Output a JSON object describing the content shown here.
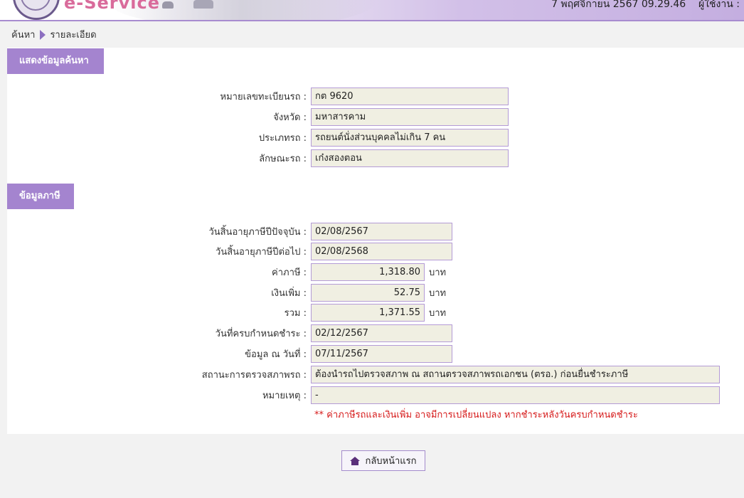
{
  "header": {
    "brand": "e-Service",
    "datetime": "7 พฤศจิกายน 2567 09.29.46",
    "user_label": "ผู้ใช้งาน :"
  },
  "breadcrumb": {
    "search": "ค้นหา",
    "detail": "รายละเอียด"
  },
  "vehicle_section": {
    "title": "แสดงข้อมูลค้นหา",
    "fields": [
      {
        "label": "หมายเลขทะเบียนรถ :",
        "value": "กต 9620"
      },
      {
        "label": "จังหวัด :",
        "value": "มหาสารคาม"
      },
      {
        "label": "ประเภทรถ :",
        "value": "รถยนต์นั่งส่วนบุคคลไม่เกิน 7 คน"
      },
      {
        "label": "ลักษณะรถ :",
        "value": "เก๋งสองตอน"
      }
    ]
  },
  "tax_section": {
    "title": "ข้อมูลภาษี",
    "current_expiry": {
      "label": "วันสิ้นอายุภาษีปีปัจจุบัน :",
      "value": "02/08/2567"
    },
    "next_expiry": {
      "label": "วันสิ้นอายุภาษีปีต่อไป :",
      "value": "02/08/2568"
    },
    "tax": {
      "label": "ค่าภาษี :",
      "value": "1,318.80",
      "unit": "บาท"
    },
    "surcharge": {
      "label": "เงินเพิ่ม :",
      "value": "52.75",
      "unit": "บาท"
    },
    "total": {
      "label": "รวม :",
      "value": "1,371.55",
      "unit": "บาท"
    },
    "due_date": {
      "label": "วันที่ครบกำหนดชำระ :",
      "value": "02/12/2567"
    },
    "data_as_of": {
      "label": "ข้อมูล ณ วันที่ :",
      "value": "07/11/2567"
    },
    "inspection_status": {
      "label": "สถานะการตรวจสภาพรถ :",
      "value": "ต้องนำรถไปตรวจสภาพ ณ สถานตรวจสภาพรถเอกชน (ตรอ.) ก่อนยื่นชำระภาษี"
    },
    "remark": {
      "label": "หมายเหตุ :",
      "value": "-"
    },
    "note": "** ค่าภาษีรถและเงินเพิ่ม อาจมีการเปลี่ยนแปลง หากชำระหลังวันครบกำหนดชำระ"
  },
  "home_button": {
    "label": "กลับหน้าแรก"
  }
}
